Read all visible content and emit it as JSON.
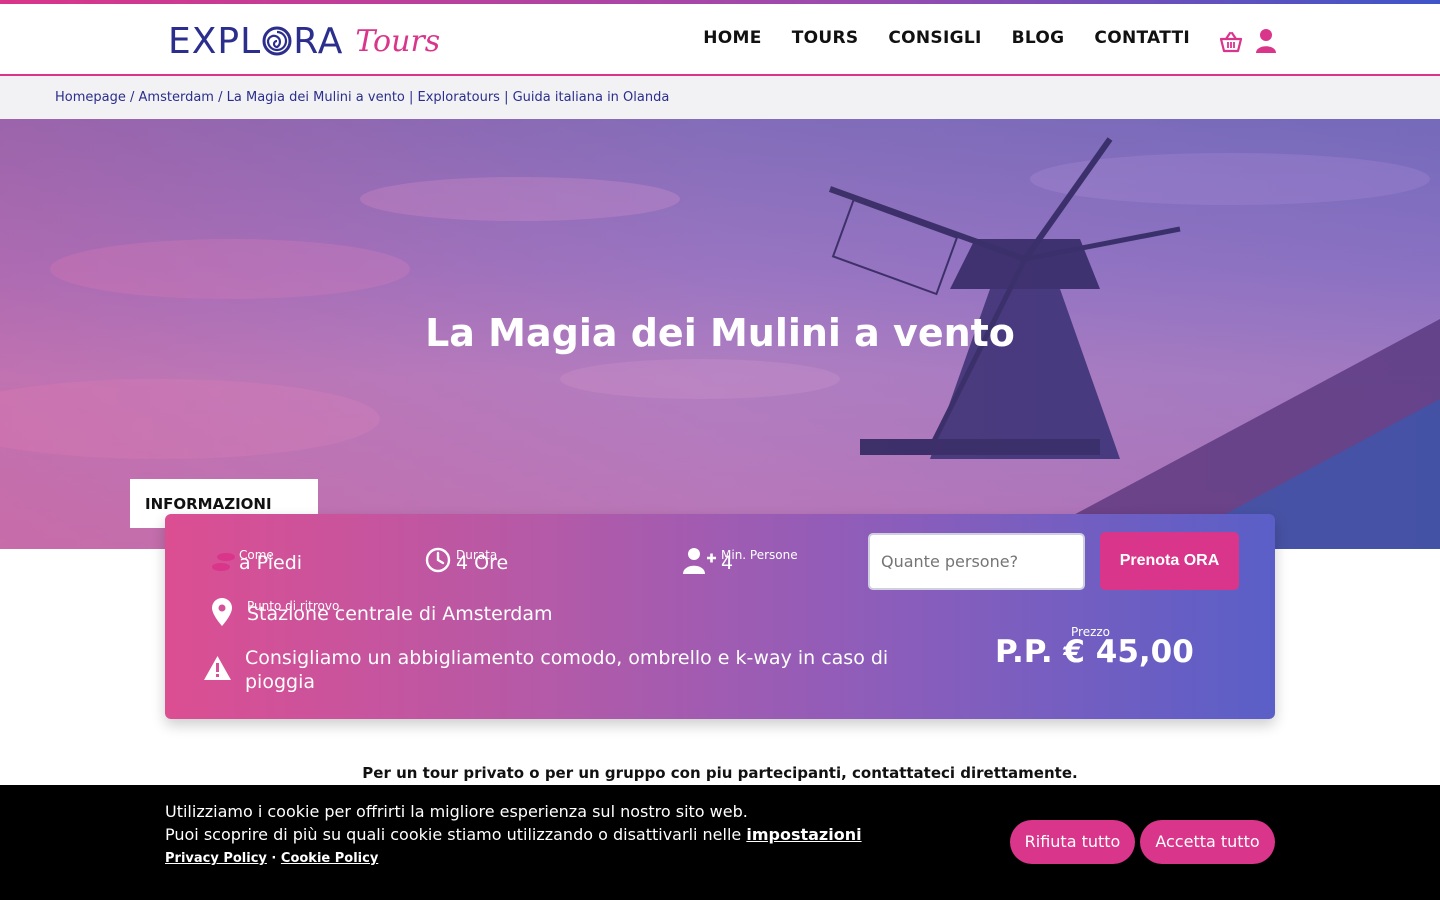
{
  "brand": {
    "name_main_left": "EXPL",
    "name_main_right": "RA",
    "name_script": "Tours"
  },
  "nav": {
    "items": [
      "HOME",
      "TOURS",
      "CONSIGLI",
      "BLOG",
      "CONTATTI"
    ]
  },
  "breadcrumb": {
    "items": [
      "Homepage",
      "Amsterdam",
      "La Magia dei Mulini a vento | Exploratours | Guida italiana in Olanda"
    ],
    "separator": "/"
  },
  "hero": {
    "title": "La Magia dei Mulini a vento"
  },
  "info": {
    "tab_label": "INFORMAZIONI",
    "come_label": "Come",
    "come_value": "a Piedi",
    "durata_label": "Durata",
    "durata_value": "4 Ore",
    "min_persone_label": "Min. Persone",
    "min_persone_value": "4",
    "punto_label": "Punto di ritrovo",
    "punto_value": "Stazione centrale di Amsterdam",
    "warning_line1": "Consigliamo un abbigliamento comodo, ombrello e k-way in caso di",
    "warning_line2": "pioggia",
    "qty_placeholder": "Quante persone?",
    "book_button": "Prenota ORA",
    "price_label": "Prezzo",
    "price_value": "P.P. € 45,00"
  },
  "private_note": "Per un tour privato o per un gruppo con piu partecipanti, contattateci direttamente.",
  "cookie": {
    "line1": "Utilizziamo i cookie per offrirti la migliore esperienza sul nostro sito web.",
    "line2_prefix": "Puoi scoprire di più su quali cookie stiamo utilizzando o disattivarli nelle ",
    "line2_link": "impostazioni",
    "privacy_link": "Privacy Policy",
    "separator": " · ",
    "cookie_link": "Cookie Policy",
    "reject_button": "Rifiuta tutto",
    "accept_button": "Accetta tutto"
  },
  "colors": {
    "brand_blue": "#2b2e8c",
    "brand_pink": "#d9358a",
    "card_gradient_end": "#5a5fc7"
  },
  "icons": [
    "cart-icon",
    "user-icon",
    "shoe-icon",
    "clock-icon",
    "add-user-icon",
    "location-pin-icon",
    "warning-icon"
  ]
}
